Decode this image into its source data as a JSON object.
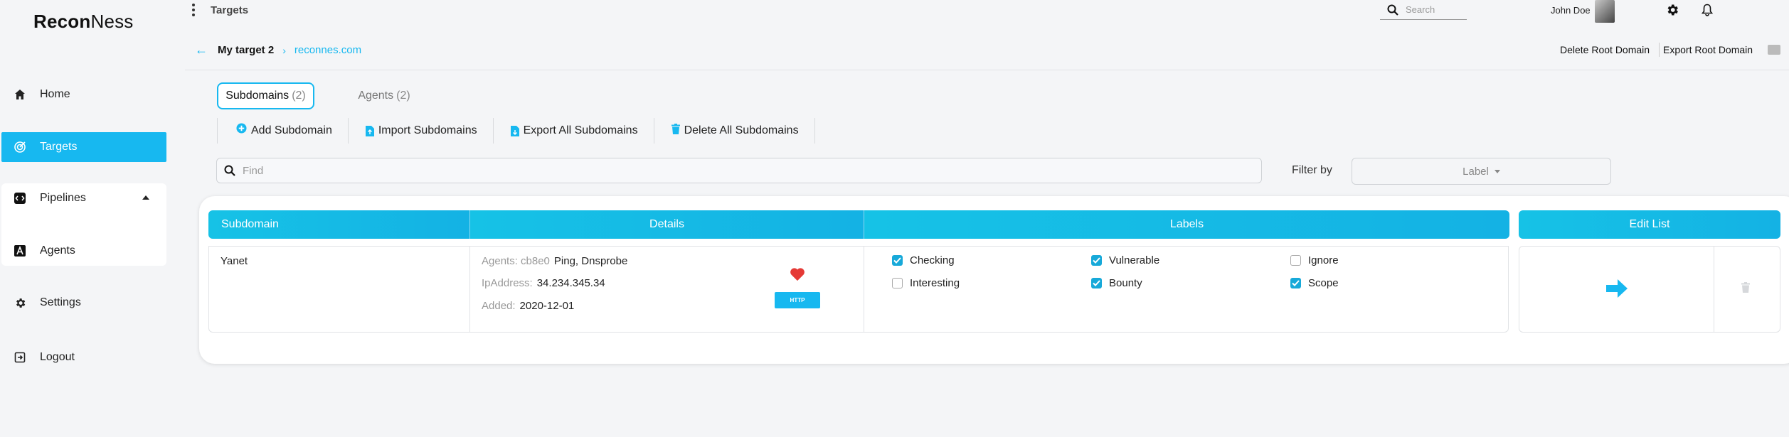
{
  "app": {
    "logo_bold": "Recon",
    "logo_light": "Ness"
  },
  "sidebar": {
    "items": [
      {
        "label": "Home",
        "icon": "home-icon"
      },
      {
        "label": "Targets",
        "icon": "target-icon",
        "active": true
      },
      {
        "label": "Pipelines",
        "icon": "pipeline-icon"
      },
      {
        "label": "Agents",
        "icon": "agent-icon"
      },
      {
        "label": "Settings",
        "icon": "gear-icon"
      },
      {
        "label": "Logout",
        "icon": "logout-icon"
      }
    ]
  },
  "topbar": {
    "title": "Targets",
    "search_placeholder": "Search",
    "user_name": "John Doe"
  },
  "breadcrumb": {
    "target": "My target 2",
    "root_domain": "reconnes.com"
  },
  "top_actions": {
    "delete_root": "Delete Root Domain",
    "export_root": "Export Root Domain"
  },
  "tabs": [
    {
      "label": "Subdomains",
      "count": "(2)",
      "active": true
    },
    {
      "label": "Agents",
      "count": "(2)",
      "active": false
    }
  ],
  "actions": {
    "add": "Add Subdomain",
    "import": "Import Subdomains",
    "export": "Export All Subdomains",
    "delete": "Delete All Subdomains"
  },
  "find": {
    "placeholder": "Find"
  },
  "filter": {
    "label": "Filter by",
    "select_value": "Label"
  },
  "table": {
    "headers": {
      "subdomain": "Subdomain",
      "details": "Details",
      "labels": "Labels",
      "edit": "Edit List"
    },
    "row": {
      "subdomain": "Yanet",
      "agents_key": "Agents: cb8e0",
      "agents_value": "Ping, Dnsprobe",
      "ip_key": "IpAddress:",
      "ip_value": "34.234.345.34",
      "added_key": "Added:",
      "added_value": "2020-12-01",
      "http_button": "HTTP",
      "labels": [
        {
          "name": "Checking",
          "checked": true
        },
        {
          "name": "Vulnerable",
          "checked": true
        },
        {
          "name": "Ignore",
          "checked": false
        },
        {
          "name": "Interesting",
          "checked": false
        },
        {
          "name": "Bounty",
          "checked": true
        },
        {
          "name": "Scope",
          "checked": true
        }
      ]
    }
  },
  "colors": {
    "accent": "#17b8f0",
    "heart": "#e53935"
  }
}
